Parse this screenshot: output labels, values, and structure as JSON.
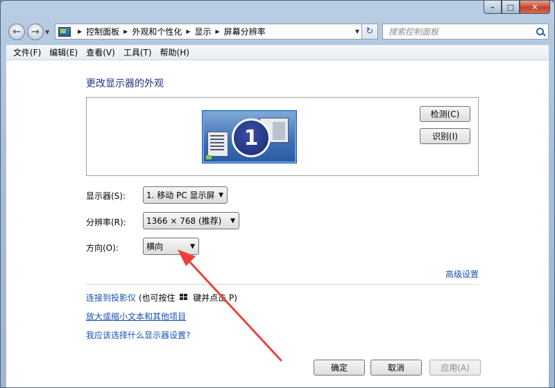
{
  "window": {
    "min_glyph": "–",
    "max_glyph": "□",
    "close_glyph": "✕"
  },
  "breadcrumb": [
    "控制面板",
    "外观和个性化",
    "显示",
    "屏幕分辨率"
  ],
  "search": {
    "placeholder": "搜索控制面板"
  },
  "menu": [
    "文件(F)",
    "编辑(E)",
    "查看(V)",
    "工具(T)",
    "帮助(H)"
  ],
  "page": {
    "heading": "更改显示器的外观",
    "monitor_number": "1",
    "detect_label": "检测(C)",
    "identify_label": "识别(I)"
  },
  "fields": {
    "display_label": "显示器(S):",
    "display_value": "1. 移动 PC 显示屏",
    "resolution_label": "分辨率(R):",
    "resolution_value": "1366 × 768 (推荐)",
    "orientation_label": "方向(O):",
    "orientation_value": "横向"
  },
  "links": {
    "advanced": "高级设置",
    "projector": "连接到投影仪",
    "projector_hint_pre": "(也可按住",
    "projector_hint_post": "键并点击 P)",
    "enlarge_text": "放大或缩小文本和其他项目",
    "which_settings": "我应该选择什么显示器设置?"
  },
  "buttons": {
    "ok": "确定",
    "cancel": "取消",
    "apply": "应用(A)"
  },
  "colors": {
    "link": "#1450b8",
    "heading": "#1e3287",
    "annotation_arrow": "#e8413c"
  }
}
